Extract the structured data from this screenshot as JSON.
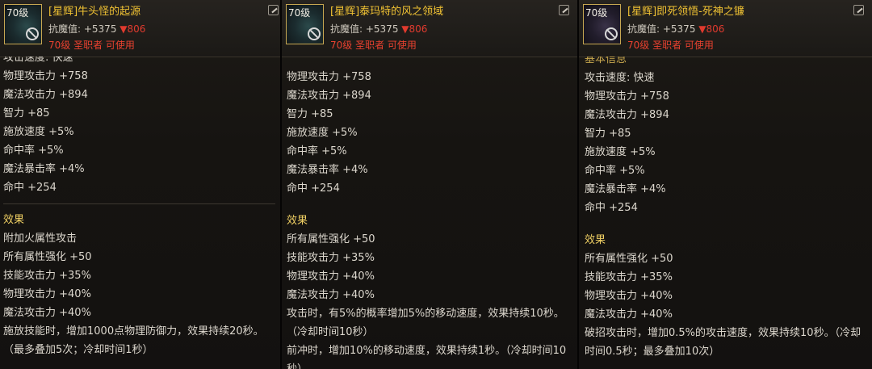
{
  "panels": [
    {
      "level_badge": "70级",
      "grade": "[星辉]",
      "name": "牛头怪的起源",
      "anti_magic_label": "抗魔值: +5375",
      "anti_magic_down": "▼806",
      "requirement": "70级 圣职者 可使用",
      "cut_top_line": "攻击速度: 快速",
      "stats": [
        "物理攻击力 +758",
        "魔法攻击力 +894",
        "智力 +85",
        "施放速度 +5%",
        "命中率 +5%",
        "魔法暴击率 +4%",
        "命中 +254"
      ],
      "effects_title": "效果",
      "effects": [
        "附加火属性攻击",
        "所有属性强化 +50",
        "技能攻击力 +35%",
        "物理攻击力 +40%",
        "魔法攻击力 +40%",
        "施放技能时，增加1000点物理防御力，效果持续20秒。（最多叠加5次；冷却时间1秒）"
      ]
    },
    {
      "level_badge": "70级",
      "grade": "[星辉]",
      "name": "泰玛特的风之领域",
      "anti_magic_label": "抗魔值: +5375",
      "anti_magic_down": "▼806",
      "requirement": "70级 圣职者 可使用",
      "stats": [
        "物理攻击力 +758",
        "魔法攻击力 +894",
        "智力 +85",
        "施放速度 +5%",
        "命中率 +5%",
        "魔法暴击率 +4%",
        "命中 +254"
      ],
      "effects_title": "效果",
      "effects": [
        "所有属性强化 +50",
        "技能攻击力 +35%",
        "物理攻击力 +40%",
        "魔法攻击力 +40%",
        "攻击时，有5%的概率增加5%的移动速度，效果持续10秒。（冷却时间10秒）",
        "前冲时，增加10%的移动速度，效果持续1秒。（冷却时间10秒）"
      ]
    },
    {
      "level_badge": "70级",
      "grade": "[星辉]",
      "name": "即死领悟-死神之镰",
      "anti_magic_label": "抗魔值: +5375",
      "anti_magic_down": "▼806",
      "requirement": "70级 圣职者 可使用",
      "cut_top_line": "基本信息",
      "stats": [
        "攻击速度: 快速",
        "物理攻击力 +758",
        "魔法攻击力 +894",
        "智力 +85",
        "施放速度 +5%",
        "命中率 +5%",
        "魔法暴击率 +4%",
        "命中 +254"
      ],
      "effects_title": "效果",
      "effects": [
        "所有属性强化 +50",
        "技能攻击力 +35%",
        "物理攻击力 +40%",
        "魔法攻击力 +40%",
        "破招攻击时，增加0.5%的攻击速度，效果持续10秒。（冷却时间0.5秒；最多叠加10次）"
      ]
    }
  ]
}
